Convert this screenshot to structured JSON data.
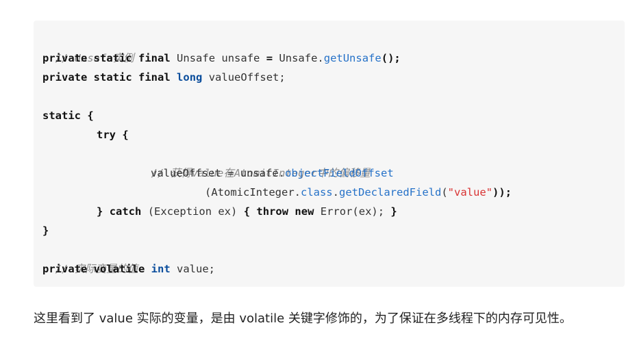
{
  "code": {
    "line1_comment": "// Unsafe实例",
    "line2": {
      "kw1": "private",
      "kw2": "static",
      "kw3": "final",
      "type": "Unsafe",
      "var": "unsafe",
      "op": "=",
      "cls": "Unsafe.",
      "method": "getUnsafe",
      "end": "();"
    },
    "line3": {
      "kw1": "private",
      "kw2": "static",
      "kw3": "final",
      "type": "long",
      "var": "valueOffset;"
    },
    "line5": {
      "kw": "static",
      "brace": "{"
    },
    "line6": {
      "kw": "try",
      "brace": "{"
    },
    "line7_comment": "// 获得value在AtomicInteger中的偏移量",
    "line8": {
      "var": "valueOffset",
      "op": "=",
      "obj": "unsafe.",
      "method": "objectFieldOffset"
    },
    "line9": {
      "open": "(AtomicInteger.",
      "kw": "class",
      "dot": ".",
      "method": "getDeclaredField",
      "paren": "(",
      "str": "\"value\"",
      "close": "));"
    },
    "line10": {
      "brace1": "}",
      "kw1": "catch",
      "args": "(Exception ex)",
      "brace2": "{",
      "kw2": "throw",
      "kw3": "new",
      "rest": "Error(ex);",
      "brace3": "}"
    },
    "line11": "}",
    "line12_comment": "// 实际变量的值",
    "line13": {
      "kw1": "private",
      "kw2": "volatile",
      "type": "int",
      "var": "value;"
    }
  },
  "paragraph": {
    "text": "这里看到了 value 实际的变量，是由 volatile 关键字修饰的，为了保证在多线程下的内存可见性。"
  }
}
